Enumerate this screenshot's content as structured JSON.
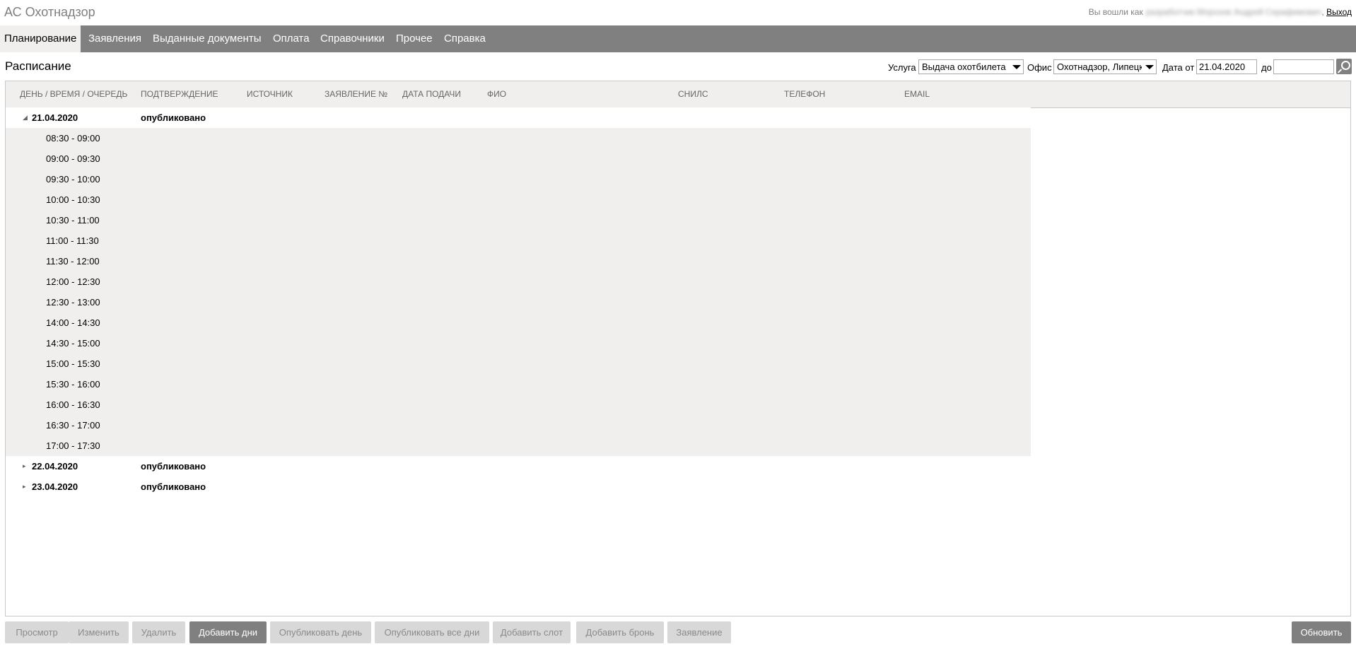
{
  "app": {
    "title": "АС Охотнадзор",
    "logged_in_prefix": "Вы вошли как",
    "user_name": "разработчик Морозов Андрей Серафимович",
    "logout_label": "Выход"
  },
  "nav": {
    "items": [
      {
        "label": "Планирование",
        "active": true
      },
      {
        "label": "Заявления",
        "active": false
      },
      {
        "label": "Выданные документы",
        "active": false
      },
      {
        "label": "Оплата",
        "active": false
      },
      {
        "label": "Справочники",
        "active": false
      },
      {
        "label": "Прочее",
        "active": false
      },
      {
        "label": "Справка",
        "active": false
      }
    ]
  },
  "toolbar": {
    "page_title": "Расписание",
    "service_label": "Услуга",
    "service_value": "Выдача охотбилета",
    "office_label": "Офис",
    "office_value": "Охотнадзор, Липецк",
    "date_from_label": "Дата от",
    "date_from_value": "21.04.2020",
    "date_to_label": "до",
    "date_to_value": "",
    "search_icon": "search-icon"
  },
  "grid": {
    "columns": [
      "ДЕНЬ / ВРЕМЯ / ОЧЕРЕДЬ",
      "ПОДТВЕРЖДЕНИЕ",
      "ИСТОЧНИК",
      "ЗАЯВЛЕНИЕ №",
      "ДАТА ПОДАЧИ",
      "ФИО",
      "СНИЛС",
      "ТЕЛЕФОН",
      "EMAIL"
    ],
    "days": [
      {
        "date": "21.04.2020",
        "status": "опубликовано",
        "expanded": true,
        "slots": [
          "08:30 - 09:00",
          "09:00 - 09:30",
          "09:30 - 10:00",
          "10:00 - 10:30",
          "10:30 - 11:00",
          "11:00 - 11:30",
          "11:30 - 12:00",
          "12:00 - 12:30",
          "12:30 - 13:00",
          "14:00 - 14:30",
          "14:30 - 15:00",
          "15:00 - 15:30",
          "15:30 - 16:00",
          "16:00 - 16:30",
          "16:30 - 17:00",
          "17:00 - 17:30"
        ]
      },
      {
        "date": "22.04.2020",
        "status": "опубликовано",
        "expanded": false,
        "slots": []
      },
      {
        "date": "23.04.2020",
        "status": "опубликовано",
        "expanded": false,
        "slots": []
      }
    ]
  },
  "footer": {
    "buttons": [
      {
        "label": "Просмотр",
        "enabled": false
      },
      {
        "label": "Изменить",
        "enabled": false
      },
      {
        "label": "Удалить",
        "enabled": false
      },
      {
        "label": "Добавить дни",
        "enabled": true
      },
      {
        "label": "Опубликовать день",
        "enabled": false
      },
      {
        "label": "Опубликовать все дни",
        "enabled": false
      },
      {
        "label": "Добавить слот",
        "enabled": false
      },
      {
        "label": "Добавить бронь",
        "enabled": false
      },
      {
        "label": "Заявление",
        "enabled": false
      }
    ],
    "refresh_label": "Обновить"
  },
  "colors": {
    "nav_bg": "#808080",
    "active_tab_bg": "#f0efed",
    "slot_bg": "#f0efed",
    "disabled_btn_bg": "#d8d8d8",
    "primary_btn_bg": "#808080"
  }
}
